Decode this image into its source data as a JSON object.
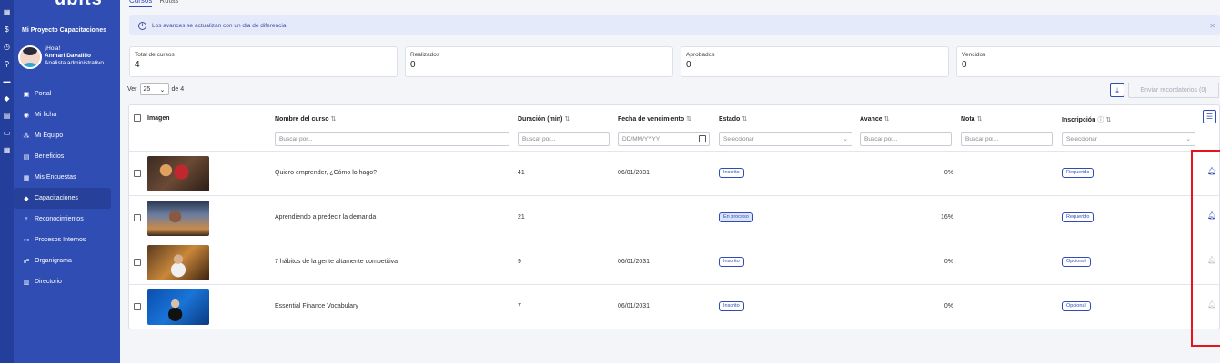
{
  "sidebar": {
    "brand": "ubits",
    "project": "Mi Proyecto Capacitaciones",
    "greeting": "¡Hola!",
    "user_name": "Anmari Davalillo",
    "user_role": "Analista administrativo",
    "items": [
      {
        "label": "Portal",
        "icon": "home-icon",
        "glyph": "▣"
      },
      {
        "label": "Mi ficha",
        "icon": "profile-icon",
        "glyph": "◉"
      },
      {
        "label": "Mi Equipo",
        "icon": "team-icon",
        "glyph": "⁂"
      },
      {
        "label": "Beneficios",
        "icon": "gift-icon",
        "glyph": "▤"
      },
      {
        "label": "Mis Encuestas",
        "icon": "survey-icon",
        "glyph": "▦"
      },
      {
        "label": "Capacitaciones",
        "icon": "graduation-icon",
        "glyph": "◆",
        "active": true
      },
      {
        "label": "Reconocimientos",
        "icon": "trophy-icon",
        "glyph": "♆"
      },
      {
        "label": "Procesos Internos",
        "icon": "process-icon",
        "glyph": "⚯"
      },
      {
        "label": "Organigrama",
        "icon": "org-chart-icon",
        "glyph": "☍"
      },
      {
        "label": "Directorio",
        "icon": "directory-icon",
        "glyph": "▥"
      }
    ]
  },
  "tabs": [
    "Cursos",
    "Rutas"
  ],
  "alert": {
    "text": "Los avances se actualizan con un día de diferencia."
  },
  "stats": [
    {
      "label": "Total de cursos",
      "value": "4"
    },
    {
      "label": "Realizados",
      "value": "0"
    },
    {
      "label": "Aprobados",
      "value": "0"
    },
    {
      "label": "Vencidos",
      "value": "0"
    }
  ],
  "pagination": {
    "ver": "Ver",
    "page_size": "25",
    "of": "de 4"
  },
  "reminder_button": "Enviar recordatorios (0)",
  "table": {
    "headers": {
      "image": "Imagen",
      "name": "Nombre del curso",
      "duration": "Duración (min)",
      "due": "Fecha de vencimiento",
      "status": "Estado",
      "progress": "Avance",
      "grade": "Nota",
      "enrollment": "Inscripción"
    },
    "filters": {
      "name": "Buscar por...",
      "duration": "Buscar por...",
      "due": "DD/MM/YYYY",
      "status": "Seleccionar",
      "progress": "Buscar por...",
      "grade": "Buscar por...",
      "enrollment": "Seleccionar"
    },
    "rows": [
      {
        "name": "Quiero emprender, ¿Cómo lo hago?",
        "duration": "41",
        "due": "06/01/2031",
        "status": "Inscrito",
        "progress": "0%",
        "enrollment": "Requerido",
        "bell_active": true
      },
      {
        "name": "Aprendiendo a predecir la demanda",
        "duration": "21",
        "due": "",
        "status": "En proceso",
        "progress": "16%",
        "enrollment": "Requerido",
        "bell_active": true
      },
      {
        "name": "7 hábitos de la gente altamente competitiva",
        "duration": "9",
        "due": "06/01/2031",
        "status": "Inscrito",
        "progress": "0%",
        "enrollment": "Opcional",
        "bell_active": false
      },
      {
        "name": "Essential Finance Vocabulary",
        "duration": "7",
        "due": "06/01/2031",
        "status": "Inscrito",
        "progress": "0%",
        "enrollment": "Opcional",
        "bell_active": false
      }
    ]
  },
  "colors": {
    "primary": "#2f4db3",
    "highlight": "#e8141b"
  }
}
